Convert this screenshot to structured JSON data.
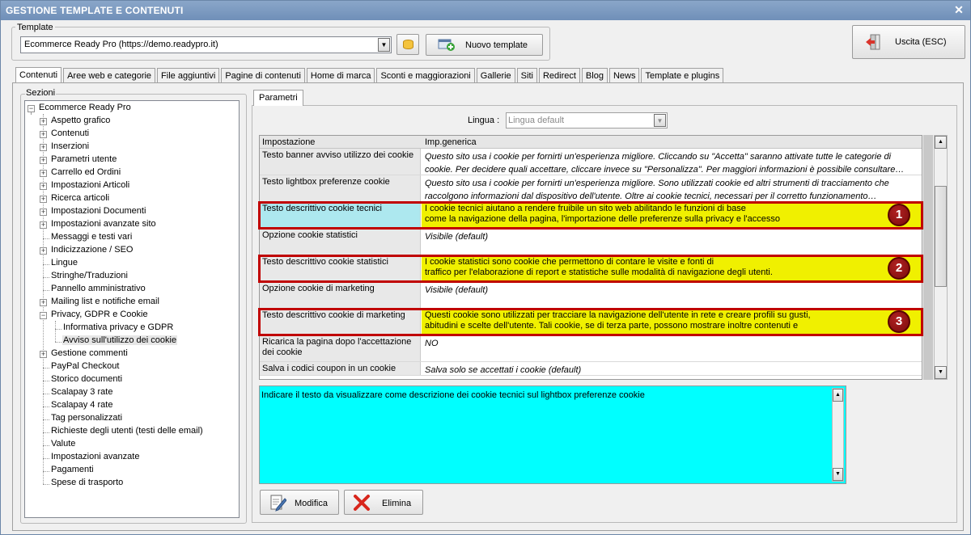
{
  "window": {
    "title": "GESTIONE TEMPLATE E CONTENUTI",
    "close_label": "✕"
  },
  "template": {
    "group_label": "Template",
    "selected": "Ecommerce Ready Pro (https://demo.readypro.it)",
    "new_button": "Nuovo template"
  },
  "exit_button": "Uscita (ESC)",
  "tabs": [
    "Contenuti",
    "Aree web e categorie",
    "File aggiuntivi",
    "Pagine di contenuti",
    "Home di marca",
    "Sconti e maggiorazioni",
    "Gallerie",
    "Siti",
    "Redirect",
    "Blog",
    "News",
    "Template e plugins"
  ],
  "sections": {
    "label": "Sezioni",
    "root": "Ecommerce Ready Pro",
    "items": [
      "Aspetto grafico",
      "Contenuti",
      "Inserzioni",
      "Parametri utente",
      "Carrello ed Ordini",
      "Impostazioni Articoli",
      "Ricerca articoli",
      "Impostazioni Documenti",
      "Impostazioni avanzate sito",
      "Messaggi e testi vari",
      "Indicizzazione / SEO",
      "Lingue",
      "Stringhe/Traduzioni",
      "Pannello amministrativo",
      "Mailing list e notifiche email",
      "Privacy, GDPR e Cookie",
      "Informativa privacy e GDPR",
      "Avviso sull'utilizzo dei cookie",
      "Gestione commenti",
      "PayPal Checkout",
      "Storico documenti",
      "Scalapay 3 rate",
      "Scalapay 4 rate",
      "Tag personalizzati",
      "Richieste degli utenti (testi delle email)",
      "Valute",
      "Impostazioni avanzate",
      "Pagamenti",
      "Spese di trasporto"
    ]
  },
  "params": {
    "tab_label": "Parametri",
    "lingua_label": "Lingua :",
    "lingua_value": "Lingua default",
    "col_setting": "Impostazione",
    "col_value": "Imp.generica",
    "rows": [
      {
        "name": "Testo banner avviso utilizzo dei cookie",
        "value": "Questo sito usa i cookie per fornirti un'esperienza migliore. Cliccando su \"Accetta\" saranno attivate tutte le categorie di cookie. Per decidere quali accettare, cliccare invece su \"Personalizza\". Per maggiori informazioni è possibile consultare…"
      },
      {
        "name": "Testo lightbox preferenze cookie",
        "value": "Questo sito usa i cookie per fornirti un'esperienza migliore. Sono utilizzati cookie ed altri strumenti di tracciamento che raccolgono informazioni dal dispositivo dell'utente. Oltre ai cookie tecnici, necessari per il corretto funzionamento…"
      },
      {
        "name": "Testo descrittivo cookie tecnici",
        "value_line1": "I cookie tecnici aiutano a rendere fruibile un sito web abilitando le funzioni di base",
        "value_line2": "come la navigazione della pagina, l'importazione delle preferenze sulla privacy e l'accesso"
      },
      {
        "name": "Opzione cookie statistici",
        "value": "Visibile (default)"
      },
      {
        "name": "Testo descrittivo cookie statistici",
        "value_line1": "I cookie statistici sono cookie che permettono di contare le visite e fonti di",
        "value_line2": "traffico per l'elaborazione di report e statistiche sulle modalità di navigazione degli utenti."
      },
      {
        "name": "Opzione cookie di marketing",
        "value": "Visibile (default)"
      },
      {
        "name": "Testo descrittivo cookie di marketing",
        "value_line1": "Questi cookie sono utilizzati per tracciare la navigazione dell'utente in rete e creare profili su gusti,",
        "value_line2": "abitudini e scelte dell'utente. Tali cookie, se di terza parte, possono mostrare inoltre contenuti e"
      },
      {
        "name": "Ricarica la pagina dopo l'accettazione dei cookie",
        "value": "NO"
      },
      {
        "name": "Salva i codici coupon in un cookie",
        "value": "Salva solo se accettati i cookie (default)"
      }
    ],
    "badges": [
      "1",
      "2",
      "3"
    ],
    "description": "Indicare il testo da visualizzare come descrizione dei cookie tecnici sul lightbox preferenze cookie",
    "modify_button": "Modifica",
    "delete_button": "Elimina"
  },
  "colors": {
    "highlight": "#f0f000",
    "selected_cell": "#ade8ef",
    "description_bg": "#00ffff",
    "marker": "#c00000"
  }
}
